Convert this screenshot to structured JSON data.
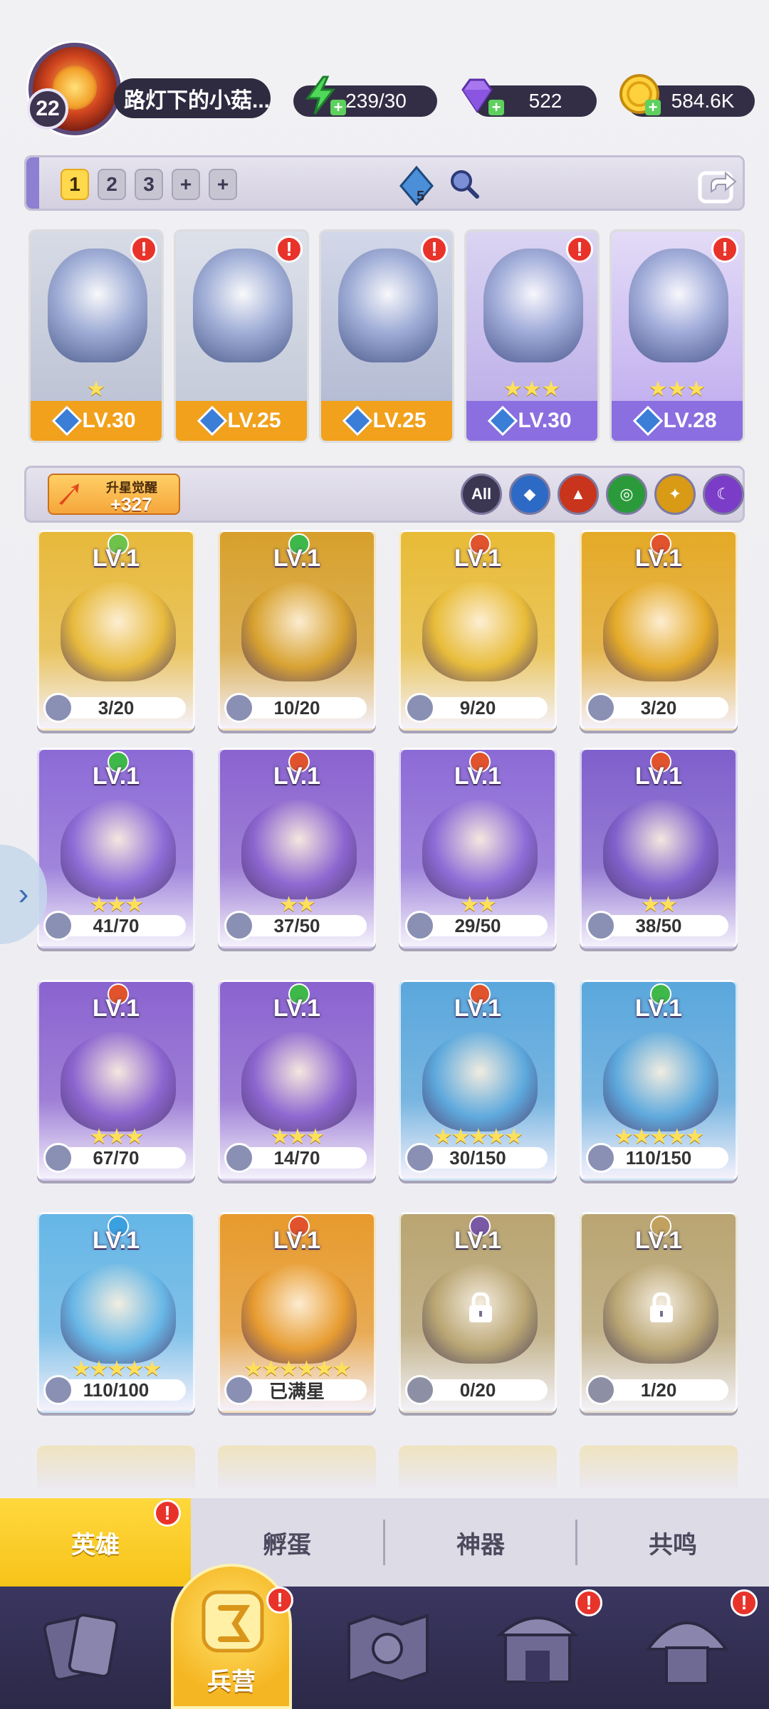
{
  "player": {
    "level": "22",
    "name": "路灯下的小菇..."
  },
  "resources": {
    "energy": "239/30",
    "gems": "522",
    "coins": "584.6K"
  },
  "team_tabs": [
    "1",
    "2",
    "3",
    "+",
    "+"
  ],
  "team_badge_count": "5",
  "team_heroes": [
    {
      "level": "LV.30",
      "stars": "★",
      "alert": "!",
      "color": "#f2a11c"
    },
    {
      "level": "LV.25",
      "stars": "",
      "alert": "!",
      "color": "#f2a11c"
    },
    {
      "level": "LV.25",
      "stars": "",
      "alert": "!",
      "color": "#f2a11c"
    },
    {
      "level": "LV.30",
      "stars": "★★★",
      "alert": "!",
      "color": "#8b6fe0"
    },
    {
      "level": "LV.28",
      "stars": "★★★",
      "alert": "!",
      "color": "#8b6fe0"
    }
  ],
  "awaken": {
    "label": "升星觉醒",
    "value": "+327"
  },
  "filters": [
    "All"
  ],
  "heroes": [
    {
      "level": "LV.1",
      "progress": "3/20",
      "stars": "",
      "bg": "#e7b93a",
      "el": "#6fc24a",
      "locked": false
    },
    {
      "level": "LV.1",
      "progress": "10/20",
      "stars": "",
      "bg": "#d7a02c",
      "el": "#3fb84a",
      "locked": false
    },
    {
      "level": "LV.1",
      "progress": "9/20",
      "stars": "",
      "bg": "#e8bb36",
      "el": "#e0532c",
      "locked": false
    },
    {
      "level": "LV.1",
      "progress": "3/20",
      "stars": "",
      "bg": "#e4a926",
      "el": "#e0532c",
      "locked": false
    },
    {
      "level": "LV.1",
      "progress": "41/70",
      "stars": "★★★",
      "bg": "#8c6ad6",
      "el": "#3fb84a",
      "locked": false
    },
    {
      "level": "LV.1",
      "progress": "37/50",
      "stars": "★★",
      "bg": "#8a63cf",
      "el": "#e0532c",
      "locked": false
    },
    {
      "level": "LV.1",
      "progress": "29/50",
      "stars": "★★",
      "bg": "#8c6ad6",
      "el": "#e0532c",
      "locked": false
    },
    {
      "level": "LV.1",
      "progress": "38/50",
      "stars": "★★",
      "bg": "#7f5fcc",
      "el": "#e0532c",
      "locked": false
    },
    {
      "level": "LV.1",
      "progress": "67/70",
      "stars": "★★★",
      "bg": "#8a63cf",
      "el": "#e0532c",
      "locked": false
    },
    {
      "level": "LV.1",
      "progress": "14/70",
      "stars": "★★★",
      "bg": "#8a63cf",
      "el": "#3fb84a",
      "locked": false
    },
    {
      "level": "LV.1",
      "progress": "30/150",
      "stars": "★★★★★",
      "bg": "#5aa7dc",
      "el": "#e0532c",
      "locked": false
    },
    {
      "level": "LV.1",
      "progress": "110/150",
      "stars": "★★★★★",
      "bg": "#5aa7dc",
      "el": "#3fb84a",
      "locked": false
    },
    {
      "level": "LV.1",
      "progress": "110/100",
      "stars": "★★★★★",
      "bg": "#65b6e6",
      "el": "#3aa0e0",
      "locked": false
    },
    {
      "level": "LV.1",
      "progress": "已满星",
      "stars": "★★★★★★",
      "bg": "#e79a2c",
      "el": "#e0532c",
      "locked": false
    },
    {
      "level": "LV.1",
      "progress": "0/20",
      "stars": "",
      "bg": "#c9a447",
      "el": "#8a4fd8",
      "locked": true
    },
    {
      "level": "LV.1",
      "progress": "1/20",
      "stars": "",
      "bg": "#c9a447",
      "el": "#d9a024",
      "locked": true
    }
  ],
  "subtabs": [
    "英雄",
    "孵蛋",
    "神器",
    "共鸣"
  ],
  "subtab_alert": "!",
  "nav": {
    "active_label": "兵营",
    "alert": "!"
  }
}
